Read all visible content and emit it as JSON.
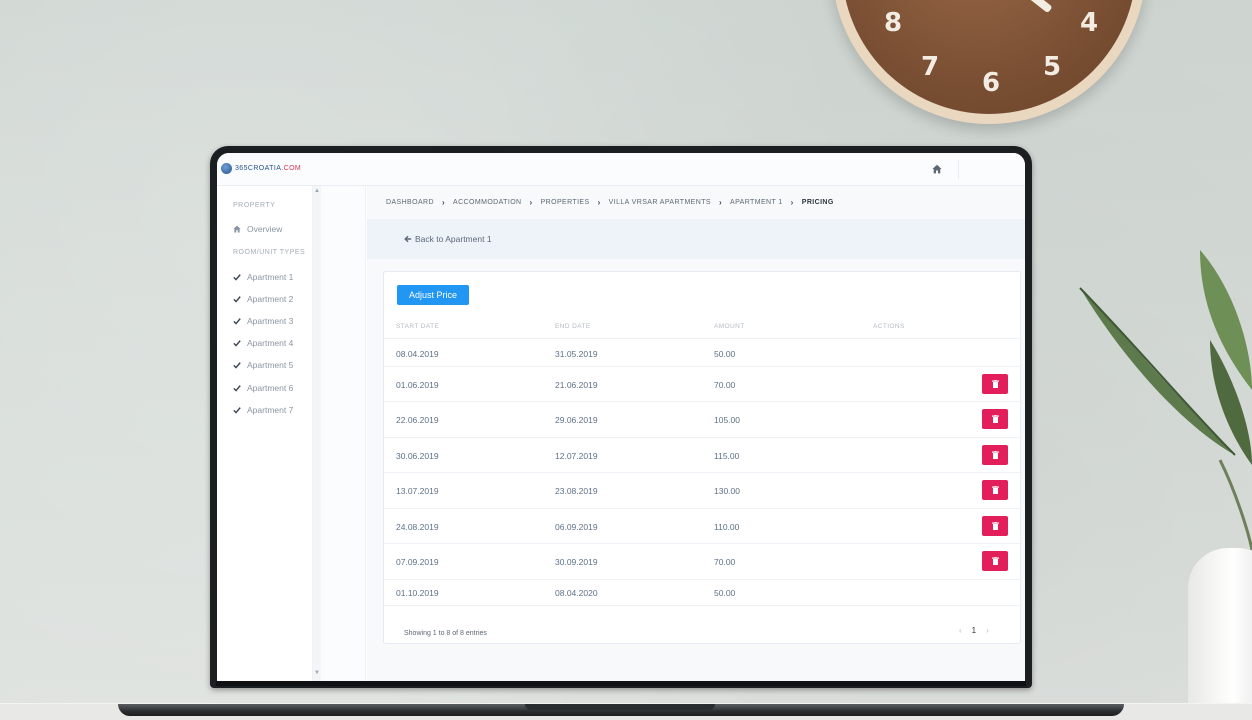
{
  "app": {
    "logo": {
      "prefix": "365CROATIA",
      "suffix": ".COM"
    }
  },
  "sidebar": {
    "section_property": "PROPERTY",
    "overview": "Overview",
    "section_units": "ROOM/UNIT TYPES",
    "units": [
      "Apartment 1",
      "Apartment 2",
      "Apartment 3",
      "Apartment 4",
      "Apartment 5",
      "Apartment 6",
      "Apartment 7"
    ]
  },
  "breadcrumb": [
    "DASHBOARD",
    "ACCOMMODATION",
    "PROPERTIES",
    "VILLA VRSAR APARTMENTS",
    "APARTMENT 1",
    "PRICING"
  ],
  "back_link": "Back to Apartment 1",
  "table": {
    "adjust_label": "Adjust Price",
    "headers": [
      "START DATE",
      "END DATE",
      "AMOUNT",
      "ACTIONS"
    ],
    "rows": [
      {
        "start": "08.04.2019",
        "end": "31.05.2019",
        "amount": "50.00",
        "delete": false
      },
      {
        "start": "01.06.2019",
        "end": "21.06.2019",
        "amount": "70.00",
        "delete": true
      },
      {
        "start": "22.06.2019",
        "end": "29.06.2019",
        "amount": "105.00",
        "delete": true
      },
      {
        "start": "30.06.2019",
        "end": "12.07.2019",
        "amount": "115.00",
        "delete": true
      },
      {
        "start": "13.07.2019",
        "end": "23.08.2019",
        "amount": "130.00",
        "delete": true
      },
      {
        "start": "24.08.2019",
        "end": "06.09.2019",
        "amount": "110.00",
        "delete": true
      },
      {
        "start": "07.09.2019",
        "end": "30.09.2019",
        "amount": "70.00",
        "delete": true
      },
      {
        "start": "01.10.2019",
        "end": "08.04.2020",
        "amount": "50.00",
        "delete": false
      }
    ],
    "info": "Showing 1 to 8 of 8 entries",
    "pagination": {
      "prev": "‹",
      "current": "1",
      "next": "›"
    }
  },
  "colors": {
    "primary": "#2196f3",
    "danger": "#e21f5a",
    "brand": "#27538d",
    "brand_accent": "#d9334f"
  },
  "clock": {
    "numbers": [
      "8",
      "7",
      "6",
      "5",
      "4"
    ]
  }
}
